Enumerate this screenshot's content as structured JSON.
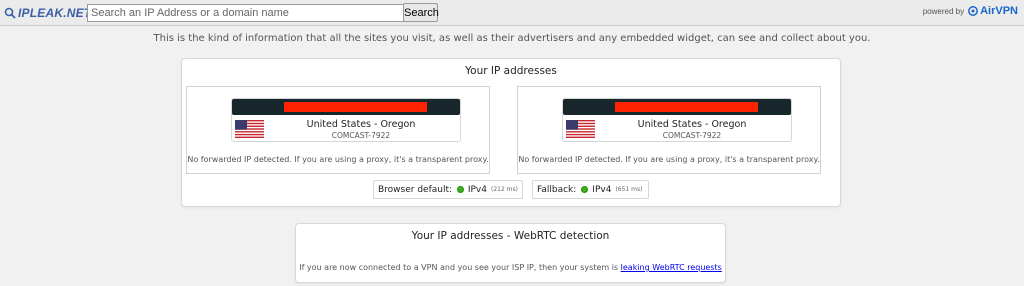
{
  "header": {
    "logo_text": "IPLEAK.NET",
    "search": {
      "placeholder": "Search an IP Address or a domain name",
      "value": ""
    },
    "search_button": "Search",
    "powered_by": "powered by",
    "brand": "AirVPN"
  },
  "tagline": "This is the kind of information that all the sites you visit, as well as their advertisers and any embedded widget, can see and collect about you.",
  "ip_addresses": {
    "title": "Your IP addresses",
    "entries": [
      {
        "country": "United States - Oregon",
        "isp": "COMCAST-7922",
        "flag": "us-flag-icon",
        "note": "No forwarded IP detected. If you are using a proxy, it's a transparent proxy."
      },
      {
        "country": "United States - Oregon",
        "isp": "COMCAST-7922",
        "flag": "us-flag-icon",
        "note": "No forwarded IP detected. If you are using a proxy, it's a transparent proxy."
      }
    ],
    "browser_default": {
      "label": "Browser default:",
      "protocol": "IPv4",
      "time": "(212 ms)"
    },
    "fallback": {
      "label": "Fallback:",
      "protocol": "IPv4",
      "time": "(651 ms)"
    },
    "status_color": "#37b51a"
  },
  "webrtc": {
    "title": "Your IP addresses - WebRTC detection",
    "note": "If you are now connected to a VPN and you see your ISP IP, then your system is",
    "link": "leaking WebRTC requests"
  },
  "colors": {
    "redaction": "#ff2200",
    "ip_bar": "#17262b",
    "link": "#0000ee"
  }
}
